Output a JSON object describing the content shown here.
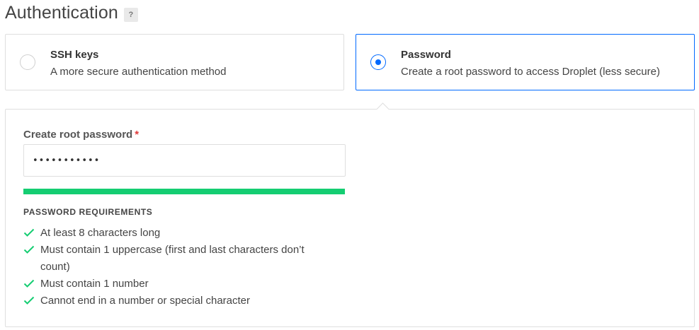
{
  "header": {
    "title": "Authentication",
    "help_label": "?"
  },
  "options": [
    {
      "label": "SSH keys",
      "description": "A more secure authentication method",
      "selected": false
    },
    {
      "label": "Password",
      "description": "Create a root password to access Droplet (less secure)",
      "selected": true
    }
  ],
  "password_form": {
    "label": "Create root password",
    "required_mark": "*",
    "value": "•••••••••••",
    "strength_fraction": 1.0,
    "strength_color": "#15cd72",
    "requirements_heading": "PASSWORD REQUIREMENTS",
    "requirements": [
      {
        "text": "At least 8 characters long",
        "met": true,
        "icon": "check-icon"
      },
      {
        "text": "Must contain 1 uppercase (first and last characters don’t count)",
        "met": true,
        "icon": "check-icon"
      },
      {
        "text": "Must contain 1 number",
        "met": true,
        "icon": "check-icon"
      },
      {
        "text": "Cannot end in a number or special character",
        "met": true,
        "icon": "check-icon"
      }
    ]
  },
  "colors": {
    "accent": "#0069ff",
    "success": "#15cd72",
    "required": "#e03b3b"
  }
}
